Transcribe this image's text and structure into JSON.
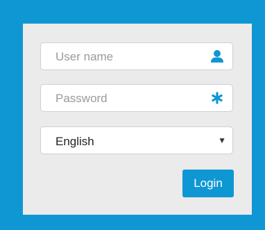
{
  "login_form": {
    "username": {
      "placeholder": "User name",
      "icon": "user-icon"
    },
    "password": {
      "placeholder": "Password",
      "icon": "asterisk-icon"
    },
    "language": {
      "selected": "English",
      "icon": "chevron-down-icon"
    },
    "login_label": "Login"
  },
  "colors": {
    "accent": "#0f97d3",
    "panel_background": "#ebebeb",
    "placeholder_text": "#9a9a9a"
  }
}
